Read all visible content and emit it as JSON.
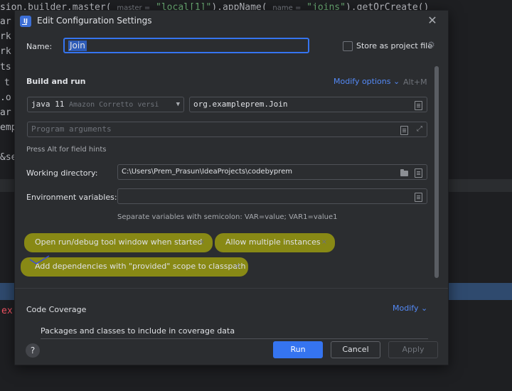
{
  "editor": {
    "lines": [
      {
        "pre": "sion.builder.master(",
        "h1": "master =",
        "s1": "\"local[1]\"",
        "mid": ").appName(",
        "h2": "name =",
        "s2": "\"joins\"",
        "post": ").getOrCreate()"
      },
      {
        "text": "ar"
      },
      {
        "text": "rk"
      },
      {
        "text": "rk"
      },
      {
        "text": "ts"
      },
      {
        "text": "t"
      },
      {
        "text": ".o"
      },
      {
        "text": "ar"
      },
      {
        "text": "emp"
      },
      {
        "text": "&se"
      }
    ],
    "error_prefix": "ex"
  },
  "dialog": {
    "title": "Edit Configuration Settings",
    "close_glyph": "✕",
    "name_label": "Name:",
    "name_value": "Join",
    "store_label": "Store as project file",
    "gear_glyph": "⚙",
    "build_title": "Build and run",
    "modify_options": "Modify options",
    "modify_chevron": "⌄",
    "modify_shortcut": "Alt+M",
    "jdk_main": "java 11",
    "jdk_detail": "Amazon Corretto versi",
    "jdk_arrow": "▼",
    "main_class": "org.exampleprem.Join",
    "program_args_placeholder": "Program arguments",
    "expand_glyph": "⤢",
    "field_hint": "Press Alt for field hints",
    "working_dir_label": "Working directory:",
    "working_dir_value": "C:\\Users\\Prem_Prasun\\IdeaProjects\\codebyprem",
    "env_label": "Environment variables:",
    "env_value": "",
    "env_hint": "Separate variables with semicolon: VAR=value; VAR1=value1",
    "tag_close": "×",
    "tags": [
      "Open run/debug tool window when started",
      "Allow multiple instances",
      "Add dependencies with \"provided\" scope to classpath"
    ],
    "coverage_title": "Code Coverage",
    "coverage_modify": "Modify",
    "packages_label": "Packages and classes to include in coverage data",
    "help": "?",
    "buttons": {
      "run": "Run",
      "cancel": "Cancel",
      "apply": "Apply"
    }
  },
  "colors": {
    "accent": "#3574f0",
    "link": "#548af7",
    "highlight": "#d6d600",
    "dialog_bg": "#2b2d30"
  }
}
